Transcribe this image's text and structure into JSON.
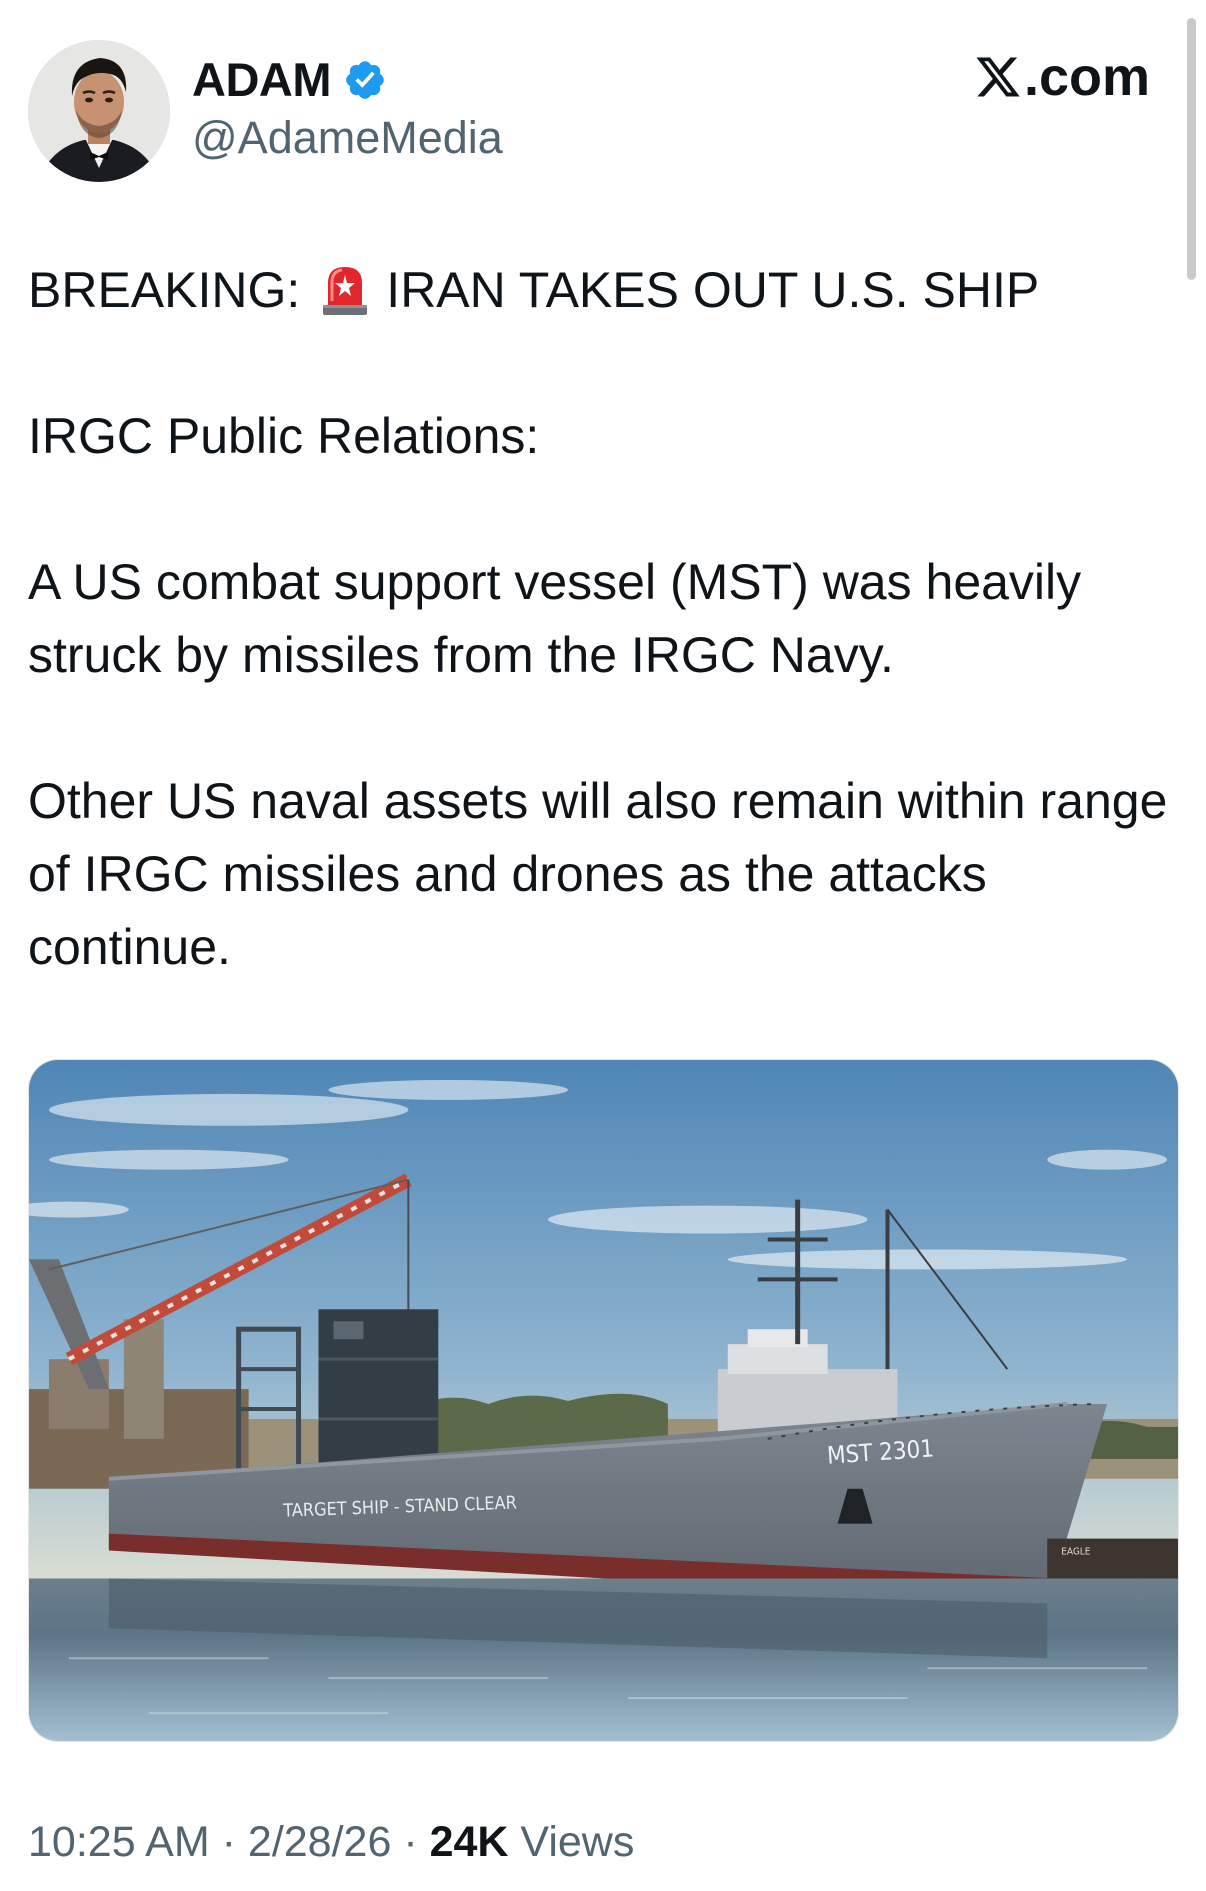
{
  "author": {
    "display_name": "ADAM",
    "handle": "@AdameMedia",
    "verified": true,
    "avatar_icon": "profile-photo"
  },
  "brand": {
    "label": ".com",
    "icon": "x-logo-icon"
  },
  "tweet": {
    "lines": [
      {
        "before": "BREAKING:",
        "icon": "rotating-light-icon",
        "after": "IRAN TAKES OUT U.S. SHIP"
      },
      {
        "text": "IRGC Public Relations:"
      },
      {
        "text": "A US combat support vessel (MST) was heavily struck by missiles from the IRGC Navy."
      },
      {
        "text": "Other US naval assets will also remain within range of IRGC missiles and drones as the attacks continue."
      }
    ]
  },
  "media": {
    "hull_label": "TARGET SHIP - STAND CLEAR",
    "bow_label": "MST 2301",
    "barge_label": "EAGLE"
  },
  "meta": {
    "time": "10:25 AM",
    "sep1": " · ",
    "date": "2/28/26",
    "sep2": " · ",
    "views_count": "24K",
    "views_label": " Views"
  },
  "colors": {
    "text": "#0f1419",
    "secondary": "#536471",
    "verified": "#1d9bf0"
  }
}
